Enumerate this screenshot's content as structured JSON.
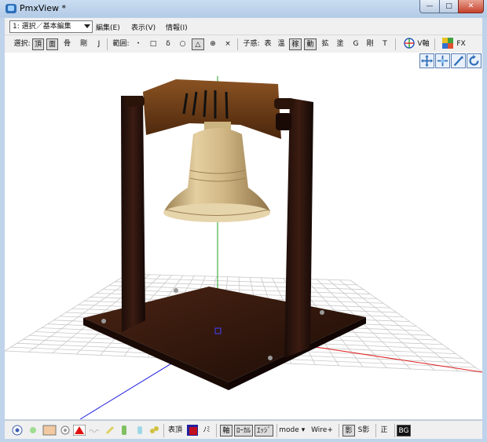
{
  "window": {
    "title": "PmxView *",
    "minimize_label": "—",
    "maximize_label": "□",
    "close_label": "✕"
  },
  "menu": {
    "mode_select": "1: 選択／基本編集",
    "items": [
      "編集(E)",
      "表示(V)",
      "情報(I)"
    ]
  },
  "toolbar": {
    "select_label": "選択:",
    "select_items": [
      "頂",
      "面",
      "骨",
      "剛",
      "J"
    ],
    "range_label": "範囲:",
    "range_items": [
      "・",
      "□",
      "δ",
      "○",
      "△",
      "⊕",
      "×"
    ],
    "target_label": "子惑:",
    "target_items": [
      "表",
      "温",
      "稼",
      "動",
      "拡",
      "塗",
      "G",
      "剛",
      "T"
    ],
    "v_axis_label": "V軸",
    "fx_label": "FX"
  },
  "statusbar": {
    "surface_label": "表頂",
    "no_label": "ﾉﾐ",
    "axis_label": "軸",
    "local_label": "ﾛｰｶﾙ",
    "edge_label": "ｴｯｼﾞ",
    "mode_label": "mode",
    "mode_arrow": "▾",
    "wire_label": "Wire+",
    "shadow_label": "影",
    "s_shadow_label": "S影",
    "ortho_label": "正",
    "bg_label": "BG"
  },
  "colors": {
    "title_bg": "#bfd3ea",
    "axis_x": "#e02020",
    "axis_y": "#20a020",
    "axis_z": "#2020e0",
    "bell": "#cdb27f",
    "wood_dark": "#2a1410",
    "wood_beam": "#6a3a16"
  }
}
